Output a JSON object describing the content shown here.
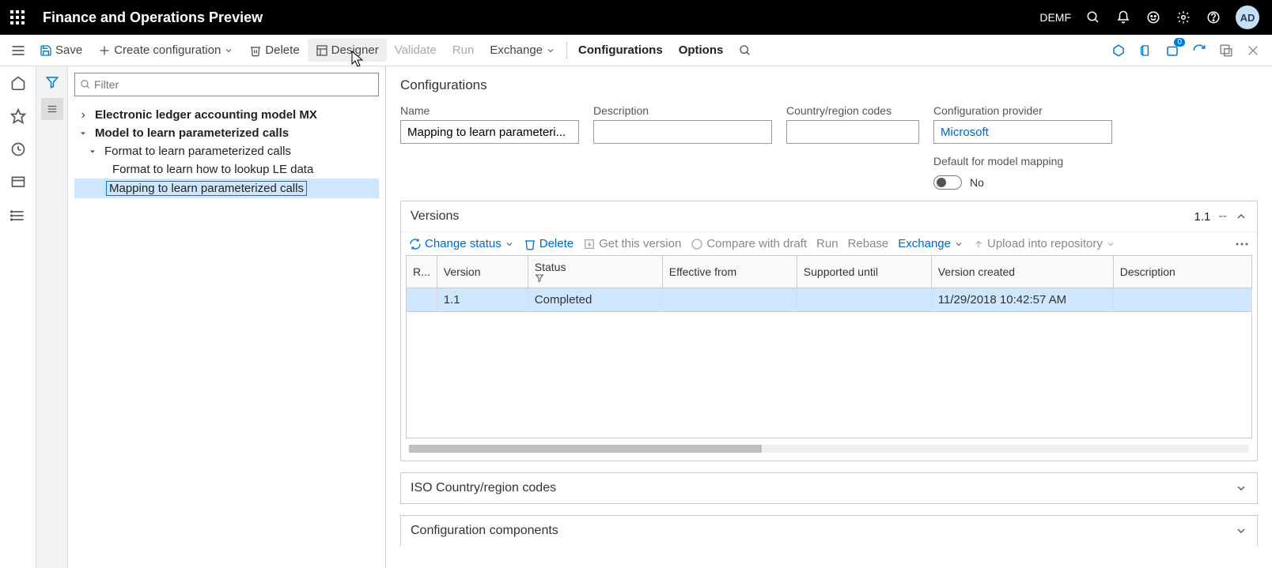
{
  "header": {
    "app_title": "Finance and Operations Preview",
    "company": "DEMF",
    "user_initials": "AD"
  },
  "cmdbar": {
    "save": "Save",
    "create_config": "Create configuration",
    "delete": "Delete",
    "designer": "Designer",
    "validate": "Validate",
    "run": "Run",
    "exchange": "Exchange",
    "configurations": "Configurations",
    "options": "Options"
  },
  "tree": {
    "filter_placeholder": "Filter",
    "nodes": {
      "n0": "Electronic ledger accounting model MX",
      "n1": "Model to learn parameterized calls",
      "n2": "Format to learn parameterized calls",
      "n3": "Format to learn how to lookup LE data",
      "n4": "Mapping to learn parameterized calls"
    }
  },
  "detail": {
    "section_title": "Configurations",
    "labels": {
      "name": "Name",
      "description": "Description",
      "country": "Country/region codes",
      "provider": "Configuration provider",
      "default_mapping": "Default for model mapping",
      "no": "No"
    },
    "values": {
      "name": "Mapping to learn parameteri...",
      "description": "",
      "country": "",
      "provider": "Microsoft"
    }
  },
  "versions": {
    "heading": "Versions",
    "current": "1.1",
    "dash": "--",
    "toolbar": {
      "change_status": "Change status",
      "delete": "Delete",
      "get_version": "Get this version",
      "compare": "Compare with draft",
      "run": "Run",
      "rebase": "Rebase",
      "exchange": "Exchange",
      "upload": "Upload into repository"
    },
    "columns": {
      "r": "R...",
      "version": "Version",
      "status": "Status",
      "effective": "Effective from",
      "supported": "Supported until",
      "created": "Version created",
      "description": "Description"
    },
    "rows": [
      {
        "version": "1.1",
        "status": "Completed",
        "effective": "",
        "supported": "",
        "created": "11/29/2018 10:42:57 AM",
        "description": ""
      }
    ]
  },
  "sections": {
    "iso": "ISO Country/region codes",
    "components": "Configuration components"
  }
}
